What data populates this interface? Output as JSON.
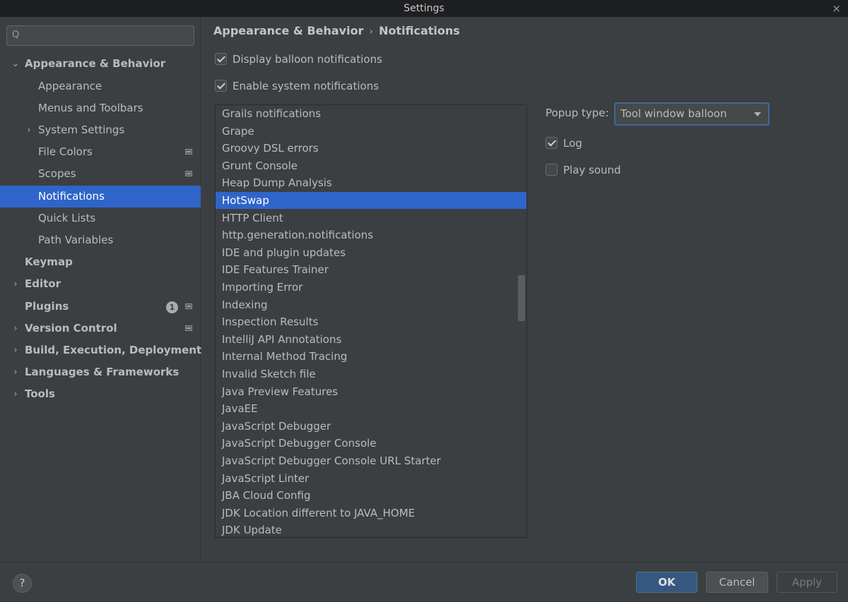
{
  "window": {
    "title": "Settings",
    "close_glyph": "×"
  },
  "search": {
    "value": "",
    "icon": "search-icon",
    "icon_glyph": "Q"
  },
  "sidebar": {
    "items": [
      {
        "label": "Appearance & Behavior",
        "expanded": true
      },
      {
        "label": "Appearance"
      },
      {
        "label": "Menus and Toolbars"
      },
      {
        "label": "System Settings"
      },
      {
        "label": "File Colors"
      },
      {
        "label": "Scopes"
      },
      {
        "label": "Notifications",
        "selected": true
      },
      {
        "label": "Quick Lists"
      },
      {
        "label": "Path Variables"
      },
      {
        "label": "Keymap"
      },
      {
        "label": "Editor"
      },
      {
        "label": "Plugins",
        "badge": "1"
      },
      {
        "label": "Version Control"
      },
      {
        "label": "Build, Execution, Deployment"
      },
      {
        "label": "Languages & Frameworks"
      },
      {
        "label": "Tools"
      }
    ]
  },
  "breadcrumb": {
    "parent": "Appearance & Behavior",
    "separator": "›",
    "current": "Notifications"
  },
  "options": {
    "display_balloon": {
      "label": "Display balloon notifications",
      "checked": true
    },
    "enable_system": {
      "label": "Enable system notifications",
      "checked": true
    }
  },
  "notification_groups": [
    "Grails notifications",
    "Grape",
    "Groovy DSL errors",
    "Grunt Console",
    "Heap Dump Analysis",
    "HotSwap",
    "HTTP Client",
    "http.generation.notifications",
    "IDE and plugin updates",
    "IDE Features Trainer",
    "Importing Error",
    "Indexing",
    "Inspection Results",
    "IntelliJ API Annotations",
    "Internal Method Tracing",
    "Invalid Sketch file",
    "Java Preview Features",
    "JavaEE",
    "JavaScript Debugger",
    "JavaScript Debugger Console",
    "JavaScript Debugger Console URL Starter",
    "JavaScript Linter",
    "JBA Cloud Config",
    "JDK Location different to JAVA_HOME",
    "JDK Update"
  ],
  "selected_group": "HotSwap",
  "group_settings": {
    "popup_type_label": "Popup type:",
    "popup_type_value": "Tool window balloon",
    "log": {
      "label": "Log",
      "checked": true
    },
    "play_sound": {
      "label": "Play sound",
      "checked": false
    }
  },
  "footer": {
    "help_label": "?",
    "ok_label": "OK",
    "cancel_label": "Cancel",
    "apply_label": "Apply"
  },
  "colors": {
    "background": "#3c3f41",
    "selection": "#2f65ca",
    "title_bar": "#1e1f21",
    "ok_button": "#365880"
  }
}
